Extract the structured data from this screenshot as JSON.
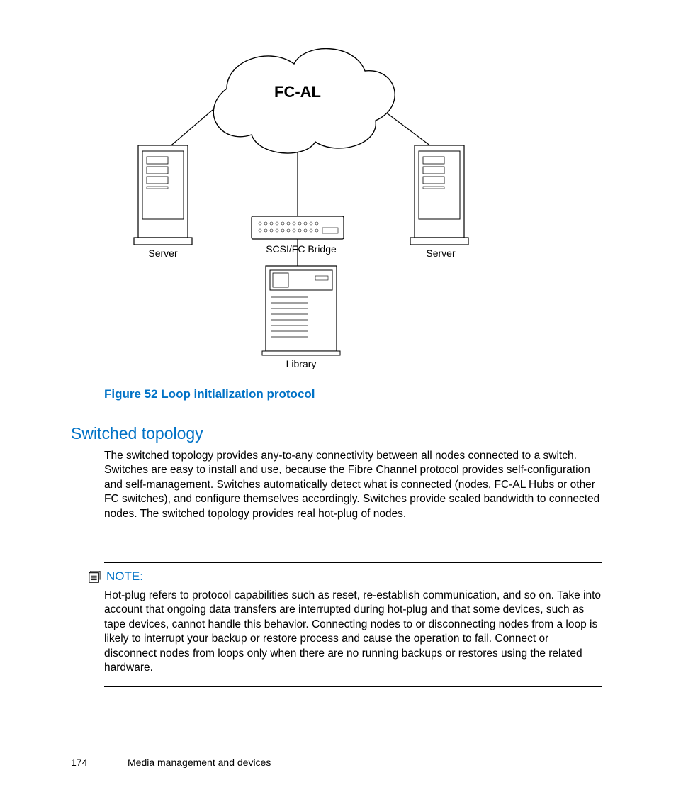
{
  "diagram": {
    "cloud_label": "FC-AL",
    "server_left": "Server",
    "server_right": "Server",
    "bridge": "SCSI/FC Bridge",
    "library": "Library"
  },
  "figure_caption": "Figure 52 Loop initialization protocol",
  "section_heading": "Switched topology",
  "paragraph": "The switched topology provides any-to-any connectivity between all nodes connected to a switch. Switches are easy to install and use, because the Fibre Channel protocol provides self-configuration and self-management. Switches automatically detect what is connected (nodes, FC-AL Hubs or other FC switches), and configure themselves accordingly. Switches provide scaled bandwidth to connected nodes. The switched topology provides real hot-plug of nodes.",
  "note_label": "NOTE:",
  "note_text": "Hot-plug refers to protocol capabilities such as reset, re-establish communication, and so on. Take into account that ongoing data transfers are interrupted during hot-plug and that some devices, such as tape devices, cannot handle this behavior. Connecting nodes to or disconnecting nodes from a loop is likely to interrupt your backup or restore process and cause the operation to fail. Connect or disconnect nodes from loops only when there are no running backups or restores using the related hardware.",
  "footer": {
    "page_number": "174",
    "chapter_title": "Media management and devices"
  }
}
